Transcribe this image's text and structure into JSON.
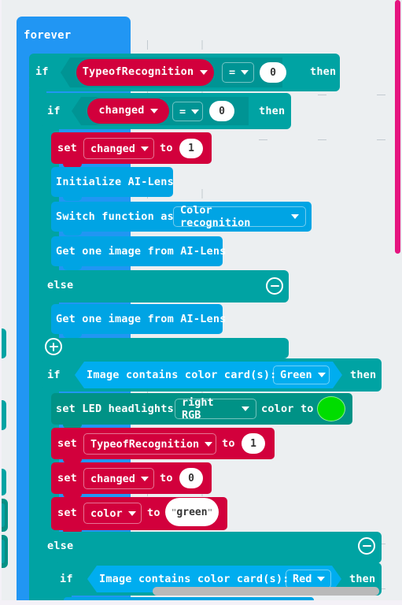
{
  "app": {
    "title": "MakeCode Blocks Editor",
    "workspace_background": "#ECEFF1"
  },
  "colors": {
    "loop_blue": "#2196F3",
    "logic_teal": "#00A3A3",
    "variable_red": "#D2003C",
    "ailens_blue": "#00A4E4",
    "led_green": "#00DD00",
    "vscrollbar_magenta": "#E5147F",
    "hscrollbar_gray": "#B9B9B9"
  },
  "program": {
    "forever": {
      "label": "forever"
    },
    "if_type": {
      "if_label": "if",
      "then_label": "then",
      "variable": "TypeofRecognition",
      "operator": "=",
      "value": "0"
    },
    "if_changed": {
      "if_label": "if",
      "then_label": "then",
      "variable": "changed",
      "operator": "=",
      "value": "0"
    },
    "set_changed_1": {
      "set_label": "set",
      "variable": "changed",
      "to_label": "to",
      "value": "1"
    },
    "init_ailens": {
      "label": "Initialize AI-Lens"
    },
    "switch_function": {
      "label": "Switch function as",
      "option": "Color recognition"
    },
    "get_image_1": {
      "label": "Get one image from AI-Lens"
    },
    "else_1": {
      "label": "else",
      "collapse_icon": "minus-circle-icon"
    },
    "get_image_2": {
      "label": "Get one image from AI-Lens"
    },
    "add_branch": {
      "icon": "plus-circle-icon"
    },
    "if_green": {
      "if_label": "if",
      "then_label": "then",
      "condition": "Image contains color card(s):",
      "option": "Green"
    },
    "set_led": {
      "prefix": "set LED headlights",
      "option": "right RGB",
      "suffix": "color to",
      "color": "#00DD00"
    },
    "set_type_1": {
      "set_label": "set",
      "variable": "TypeofRecognition",
      "to_label": "to",
      "value": "1"
    },
    "set_changed_0": {
      "set_label": "set",
      "variable": "changed",
      "to_label": "to",
      "value": "0"
    },
    "set_color_green": {
      "set_label": "set",
      "variable": "color",
      "to_label": "to",
      "value": "green",
      "quote": "\""
    },
    "else_2": {
      "label": "else",
      "collapse_icon": "minus-circle-icon"
    },
    "if_red": {
      "if_label": "if",
      "then_label": "then",
      "condition": "Image contains color card(s):",
      "option": "Red"
    }
  }
}
